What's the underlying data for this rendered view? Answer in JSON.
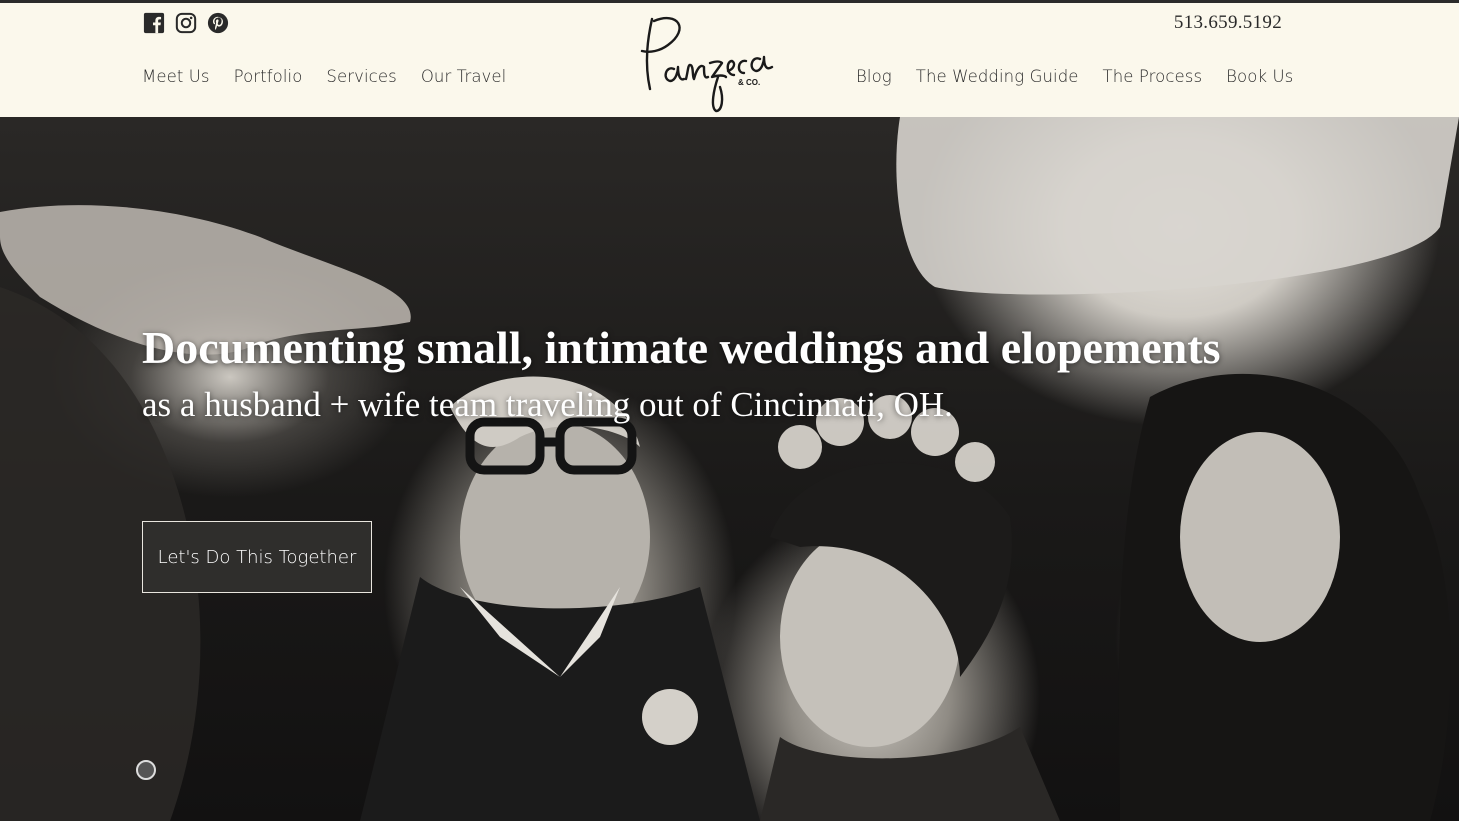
{
  "header": {
    "phone": "513.659.5192",
    "logo_text": "Panzeca",
    "logo_sub": "& CO.",
    "social": [
      {
        "icon": "facebook-icon"
      },
      {
        "icon": "instagram-icon"
      },
      {
        "icon": "pinterest-icon"
      }
    ],
    "nav_left": [
      "Meet Us",
      "Portfolio",
      "Services",
      "Our Travel"
    ],
    "nav_right": [
      "Blog",
      "The Wedding Guide",
      "The Process",
      "Book Us"
    ]
  },
  "hero": {
    "headline": "Documenting small, intimate weddings and elopements",
    "subline": "as a husband + wife team traveling out of Cincinnati, OH.",
    "cta_label": "Let's Do This Together"
  },
  "colors": {
    "header_bg": "#fbf8ec",
    "text": "#2a2a2a",
    "button_bg": "#2f2e2c"
  }
}
